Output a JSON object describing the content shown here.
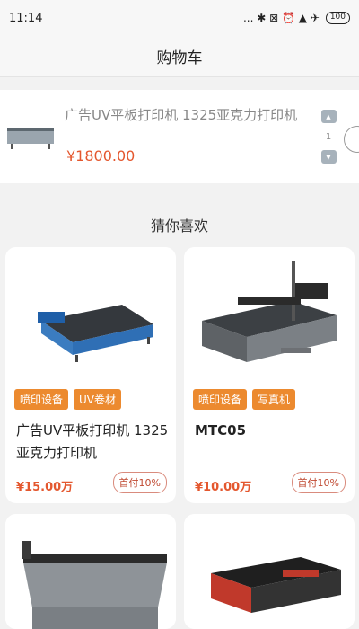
{
  "status_bar": {
    "time": "11:14",
    "icons_text": "... ✱ ⊠ ⏰ ▲ ✈",
    "battery": "100"
  },
  "nav": {
    "title": "购物车"
  },
  "cart": {
    "item": {
      "title": "广告UV平板打印机 1325亚克力打印机",
      "price": "¥1800.00",
      "quantity": "1"
    }
  },
  "recommend": {
    "title": "猜你喜欢",
    "cards": [
      {
        "tags": [
          "喷印设备",
          "UV卷材"
        ],
        "name": "广告UV平板打印机 1325亚克力打印机",
        "price": "¥15.00万",
        "badge": "首付10%"
      },
      {
        "tags": [
          "喷印设备",
          "写真机"
        ],
        "name": "MTC05",
        "price": "¥10.00万",
        "badge": "首付10%"
      }
    ]
  },
  "colors": {
    "accent_orange": "#ec8a2f",
    "price_red": "#e4572e"
  }
}
